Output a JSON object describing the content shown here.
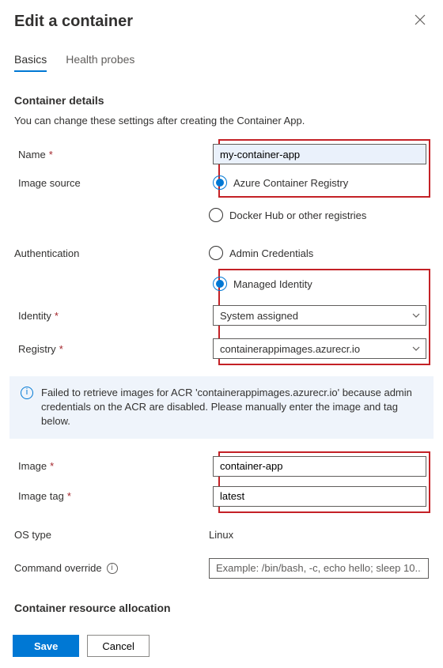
{
  "header": {
    "title": "Edit a container"
  },
  "tabs": {
    "basics": "Basics",
    "health": "Health probes"
  },
  "section": {
    "detailsHeading": "Container details",
    "detailsDesc": "You can change these settings after creating the Container App.",
    "resourceHeading": "Container resource allocation"
  },
  "labels": {
    "name": "Name",
    "imageSource": "Image source",
    "authentication": "Authentication",
    "identity": "Identity",
    "registry": "Registry",
    "image": "Image",
    "imageTag": "Image tag",
    "osType": "OS type",
    "commandOverride": "Command override"
  },
  "fields": {
    "name": "my-container-app",
    "imageSourceOptions": {
      "acr": "Azure Container Registry",
      "docker": "Docker Hub or other registries"
    },
    "authOptions": {
      "admin": "Admin Credentials",
      "managed": "Managed Identity"
    },
    "identity": "System assigned",
    "registry": "containerappimages.azurecr.io",
    "image": "container-app",
    "imageTag": "latest",
    "osType": "Linux",
    "commandOverridePlaceholder": "Example: /bin/bash, -c, echo hello; sleep 10..."
  },
  "infoMessage": "Failed to retrieve images for ACR 'containerappimages.azurecr.io' because admin credentials on the ACR are disabled. Please manually enter the image and tag below.",
  "buttons": {
    "save": "Save",
    "cancel": "Cancel"
  }
}
